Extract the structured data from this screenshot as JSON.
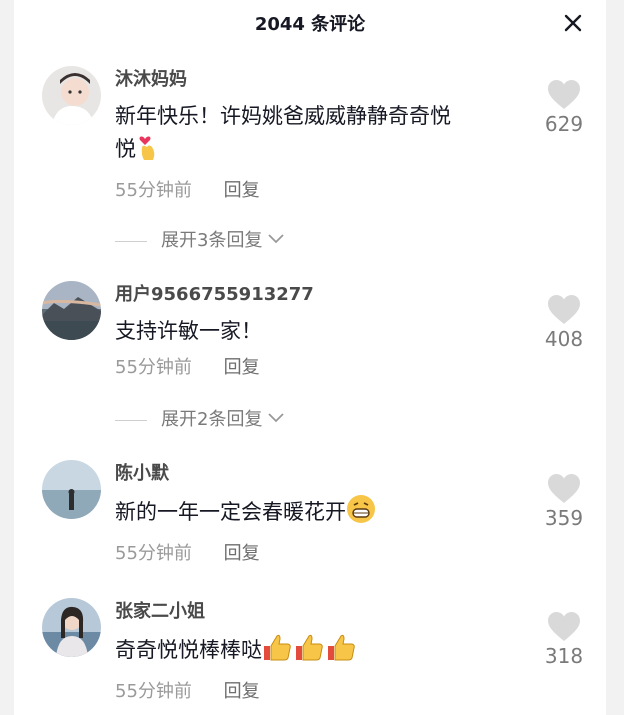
{
  "header": {
    "title": "2044 条评论"
  },
  "comments": [
    {
      "user": "沐沐妈妈",
      "text_line1": "新年快乐！许妈姚爸威威静静奇奇悦",
      "text_line2": "悦",
      "emoji": "finger-heart",
      "time": "55分钟前",
      "reply": "回复",
      "expand": "展开3条回复",
      "likes": "629"
    },
    {
      "user": "用户9566755913277",
      "text": "支持许敏一家！",
      "time": "55分钟前",
      "reply": "回复",
      "expand": "展开2条回复",
      "likes": "408"
    },
    {
      "user": "陈小默",
      "text": "新的一年一定会春暖花开",
      "emoji": "grinning-face",
      "time": "55分钟前",
      "reply": "回复",
      "likes": "359"
    },
    {
      "user": "张家二小姐",
      "text": "奇奇悦悦棒棒哒",
      "emoji": "thumbs-up-x3",
      "time": "55分钟前",
      "reply": "回复",
      "likes": "318"
    }
  ],
  "colors": {
    "like_icon": "#d9d9d9",
    "meta_text": "#9a9a9a",
    "name_text": "#4a4a4a"
  }
}
